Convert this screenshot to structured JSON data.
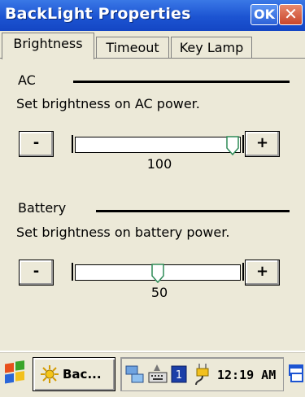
{
  "window": {
    "title": "BackLight Properties",
    "ok_label": "OK",
    "close_label": "✕"
  },
  "tabs": [
    {
      "label": "Brightness",
      "active": true
    },
    {
      "label": "Timeout",
      "active": false
    },
    {
      "label": "Key Lamp",
      "active": false
    }
  ],
  "ac": {
    "heading": "AC",
    "description": "Set brightness on AC power.",
    "minus_label": "-",
    "plus_label": "+",
    "value": "100",
    "level_percent": 100
  },
  "battery": {
    "heading": "Battery",
    "description": "Set brightness on battery power.",
    "minus_label": "-",
    "plus_label": "+",
    "value": "50",
    "level_percent": 50
  },
  "taskbar": {
    "task_label": "Bac...",
    "clock": "12:19 AM",
    "icons": [
      "start-flag-icon",
      "network-icon",
      "keyboard-icon",
      "input-panel-icon",
      "power-plug-icon",
      "desktop-icon"
    ]
  },
  "colors": {
    "titlebar": "#1c54d2",
    "close": "#c9462a",
    "face": "#ece9d8",
    "thumb_stroke": "#2e8b57"
  }
}
